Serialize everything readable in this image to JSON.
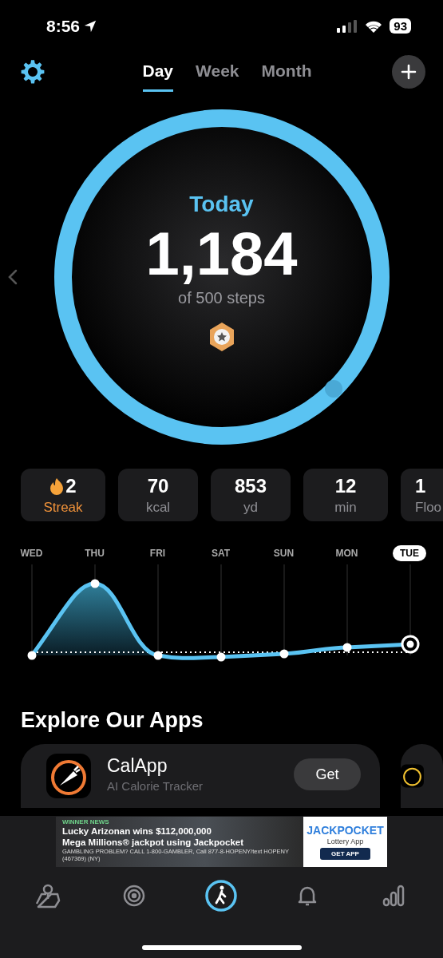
{
  "status_bar": {
    "time": "8:56",
    "battery": "93"
  },
  "tabs": [
    {
      "label": "Day",
      "selected": true
    },
    {
      "label": "Week",
      "selected": false
    },
    {
      "label": "Month",
      "selected": false
    }
  ],
  "summary": {
    "title": "Today",
    "steps": "1,184",
    "goal": "of 500 steps"
  },
  "stats": [
    {
      "kind": "streak",
      "value": "2",
      "label": "Streak"
    },
    {
      "kind": "stat",
      "value": "70",
      "label": "kcal"
    },
    {
      "kind": "stat",
      "value": "853",
      "label": "yd"
    },
    {
      "kind": "stat",
      "value": "12",
      "label": "min"
    },
    {
      "kind": "stat",
      "value": "1",
      "label": "Floo"
    }
  ],
  "week_chart": {
    "days": [
      {
        "label": "WED",
        "selected": false
      },
      {
        "label": "THU",
        "selected": false
      },
      {
        "label": "FRI",
        "selected": false
      },
      {
        "label": "SAT",
        "selected": false
      },
      {
        "label": "SUN",
        "selected": false
      },
      {
        "label": "MON",
        "selected": false
      },
      {
        "label": "TUE",
        "selected": true
      }
    ]
  },
  "explore": {
    "title": "Explore Our Apps",
    "apps": [
      {
        "name": "CalApp",
        "subtitle": "AI Calorie Tracker",
        "button": "Get"
      }
    ]
  },
  "ad": {
    "tag": "WINNER NEWS",
    "headline": "Lucky Arizonan wins $112,000,000",
    "subhead": "Mega Millions® jackpot using Jackpocket",
    "disclaimer": "GAMBLING PROBLEM? CALL 1-800-GAMBLER, Call 877-8-HOPENY/text HOPENY (467369) (NY)",
    "brand": "JACKPOCKET",
    "brand_sub": "Lottery App",
    "button": "GET APP"
  },
  "tab_bar": [
    {
      "selected": false
    },
    {
      "selected": false
    },
    {
      "selected": true
    },
    {
      "selected": false
    },
    {
      "selected": false
    }
  ]
}
